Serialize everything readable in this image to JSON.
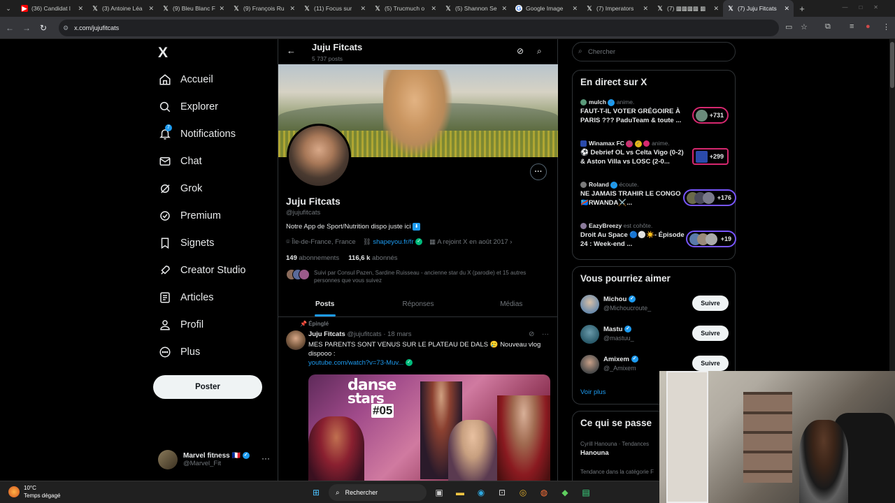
{
  "browser": {
    "tabs": [
      {
        "title": "(36) Candidat l",
        "fav": "youtube"
      },
      {
        "title": "(3) Antoine Léa",
        "fav": "x"
      },
      {
        "title": "(9) Bleu Blanc F",
        "fav": "x"
      },
      {
        "title": "(9) François Ru",
        "fav": "x"
      },
      {
        "title": "(11) Focus sur",
        "fav": "x"
      },
      {
        "title": "(5) Trucmuch o",
        "fav": "x"
      },
      {
        "title": "(5) Shannon Se",
        "fav": "x"
      },
      {
        "title": "Google Image",
        "fav": "google"
      },
      {
        "title": "(7) Imperators",
        "fav": "x"
      },
      {
        "title": "(7) ▩▩▩▩ ▩",
        "fav": "x"
      },
      {
        "title": "(7) Juju Fitcats",
        "fav": "x",
        "active": true
      }
    ],
    "new_tab": "+",
    "url": "x.com/jujufitcats"
  },
  "nav": {
    "logo": "X",
    "items": [
      {
        "label": "Accueil",
        "icon": "home-icon"
      },
      {
        "label": "Explorer",
        "icon": "search-icon"
      },
      {
        "label": "Notifications",
        "icon": "bell-icon",
        "badge": "7"
      },
      {
        "label": "Chat",
        "icon": "mail-icon"
      },
      {
        "label": "Grok",
        "icon": "grok-icon"
      },
      {
        "label": "Premium",
        "icon": "verified-icon"
      },
      {
        "label": "Signets",
        "icon": "bookmark-icon"
      },
      {
        "label": "Creator Studio",
        "icon": "rocket-icon"
      },
      {
        "label": "Articles",
        "icon": "article-icon"
      },
      {
        "label": "Profil",
        "icon": "person-icon"
      },
      {
        "label": "Plus",
        "icon": "more-circle-icon"
      }
    ],
    "post_button": "Poster",
    "account": {
      "name": "Marvel fitness 🇫🇷",
      "handle": "@Marvel_Fit"
    }
  },
  "profile": {
    "header_name": "Juju Fitcats",
    "post_count": "5 737 posts",
    "name": "Juju Fitcats",
    "handle": "@jujufitcats",
    "bio": "Notre App de Sport/Nutrition dispo juste ici",
    "bio_emoji": "⬇",
    "location": "Île-de-France, France",
    "link": "shapeyou.fr/fr",
    "joined": "A rejoint X en août 2017",
    "following_count": "149",
    "following_label": "abonnements",
    "followers_count": "116,6 k",
    "followers_label": "abonnés",
    "followed_by": "Suivi par Consul Pazen, Sardine Ruisseau - ancienne star du X (parodie) et 15 autres personnes que vous suivez",
    "tabs": [
      "Posts",
      "Réponses",
      "Médias"
    ]
  },
  "pinned_post": {
    "pinned_label": "Épinglé",
    "author": "Juju Fitcats",
    "handle": "@jujufitcats",
    "date": "· 18 mars",
    "text": "MES PARENTS SONT VENUS SUR LE PLATEAU DE DALS 🥲 Nouveau vlog dispooo :",
    "link": "youtube.com/watch?v=73-Muv...",
    "media_title_1": "danse",
    "media_title_2": "stars",
    "media_episode": "#05"
  },
  "sidebar": {
    "search_placeholder": "Chercher",
    "live_title": "En direct sur X",
    "live": [
      {
        "host": "mulch",
        "action": "anime.",
        "title": "FAUT-T-IL VOTER GRÉGOIRE À PARIS ??? PaduTeam & toute ...",
        "count": "+731"
      },
      {
        "host": "Winamax FC",
        "extra": "18",
        "action": "anime.",
        "title": "⚽ Debrief OL vs Celta Vigo (0-2) & Aston Villa vs LOSC (2-0...",
        "count": "+299"
      },
      {
        "host": "Roland",
        "action": "écoute.",
        "title": "NE JAMAIS TRAHIR LE CONGO 🇨🇩RWANDA⚔️...",
        "count": "+176"
      },
      {
        "host": "EazyBreezy",
        "action": "est cohôte.",
        "title": "Droit Au Space 🔵⚪☀️- Épisode 24 : Week-end ...",
        "count": "+19"
      }
    ],
    "suggest_title": "Vous pourriez aimer",
    "suggest": [
      {
        "name": "Michou",
        "handle": "@Michoucroute_",
        "btn": "Suivre"
      },
      {
        "name": "Mastu",
        "handle": "@mastuu_",
        "btn": "Suivre"
      },
      {
        "name": "Amixem",
        "handle": "@_Amixem",
        "btn": "Suivre"
      }
    ],
    "see_more": "Voir plus",
    "happening_title": "Ce qui se passe",
    "trends": [
      {
        "context": "Cyrill Hanouna · Tendances",
        "topic": "Hanouna"
      },
      {
        "context": "Tendance dans la catégorie F",
        "topic": ""
      }
    ]
  },
  "taskbar": {
    "temp": "10°C",
    "weather": "Temps dégagé",
    "search": "Rechercher"
  }
}
